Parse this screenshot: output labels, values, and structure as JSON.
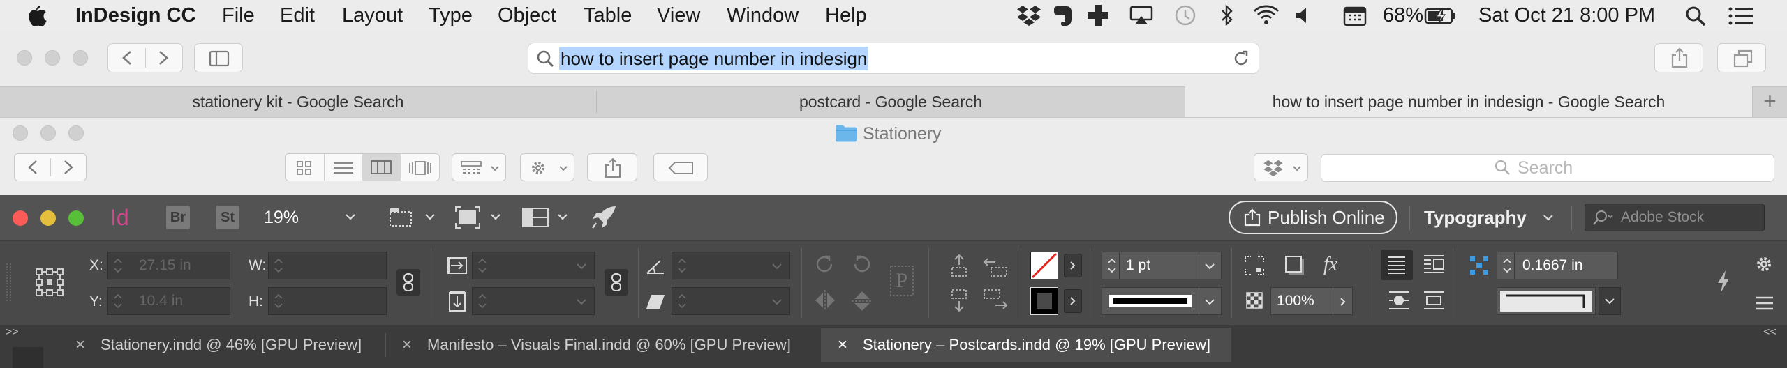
{
  "menubar": {
    "apple": "",
    "app_name": "InDesign CC",
    "items": [
      "File",
      "Edit",
      "Layout",
      "Type",
      "Object",
      "Table",
      "View",
      "Window",
      "Help"
    ],
    "battery": "68%",
    "datetime": "Sat Oct 21  8:00 PM"
  },
  "browser": {
    "url": "how to insert page number in indesign",
    "tabs": [
      {
        "label": "stationery kit - Google Search",
        "active": false
      },
      {
        "label": "postcard - Google Search",
        "active": false
      },
      {
        "label": "how to insert page number in indesign - Google Search",
        "active": true
      }
    ],
    "new_tab": "+"
  },
  "finder": {
    "title": "Stationery",
    "search_placeholder": "Search"
  },
  "indesign": {
    "badges": {
      "id": "Id",
      "br": "Br",
      "st": "St"
    },
    "zoom": "19%",
    "publish_label": "Publish Online",
    "workspace": "Typography",
    "stock_placeholder": "Adobe Stock",
    "control": {
      "x_label": "X:",
      "y_label": "Y:",
      "w_label": "W:",
      "h_label": "H:",
      "x_value": "27.15 in",
      "y_value": "10.4 in",
      "stroke_weight": "1 pt",
      "opacity": "100%",
      "offset": "0.1667 in"
    },
    "doc_tabs": [
      {
        "label": "Stationery.indd @ 46% [GPU Preview]",
        "active": false
      },
      {
        "label": "Manifesto – Visuals Final.indd @ 60% [GPU Preview]",
        "active": false
      },
      {
        "label": "Stationery – Postcards.indd @ 19% [GPU Preview]",
        "active": true
      }
    ],
    "close_glyph": "×"
  },
  "colors": {
    "indesign_pink": "#d4478a",
    "close_red": "#fc5b57",
    "minimize_yellow": "#e5bf3c",
    "zoom_green": "#57c038",
    "url_highlight": "#b4d5fe",
    "folder_blue": "#6bb7ec"
  }
}
